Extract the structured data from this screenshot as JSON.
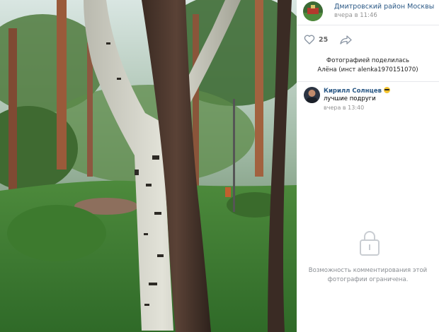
{
  "post": {
    "group_name": "Дмитровский район Москвы",
    "time": "вчера в 11:46",
    "like_count": "25",
    "shared_by_line1": "Фотографией поделилась",
    "shared_by_line2": "Алёна (инст alenka1970151070)"
  },
  "comment": {
    "author": "Кирилл Солнцев",
    "text": "лучшие подруги",
    "time": "вчера в 13:40"
  },
  "comments_restricted": {
    "line1": "Возможность комментирования этой",
    "line2": "фотографии ограничена."
  },
  "icons": {
    "like": "heart-icon",
    "share": "share-arrow-icon",
    "restricted": "lock-icon"
  },
  "colors": {
    "link": "#2a5885",
    "muted": "#939393",
    "restricted_text": "#8a8e93"
  }
}
